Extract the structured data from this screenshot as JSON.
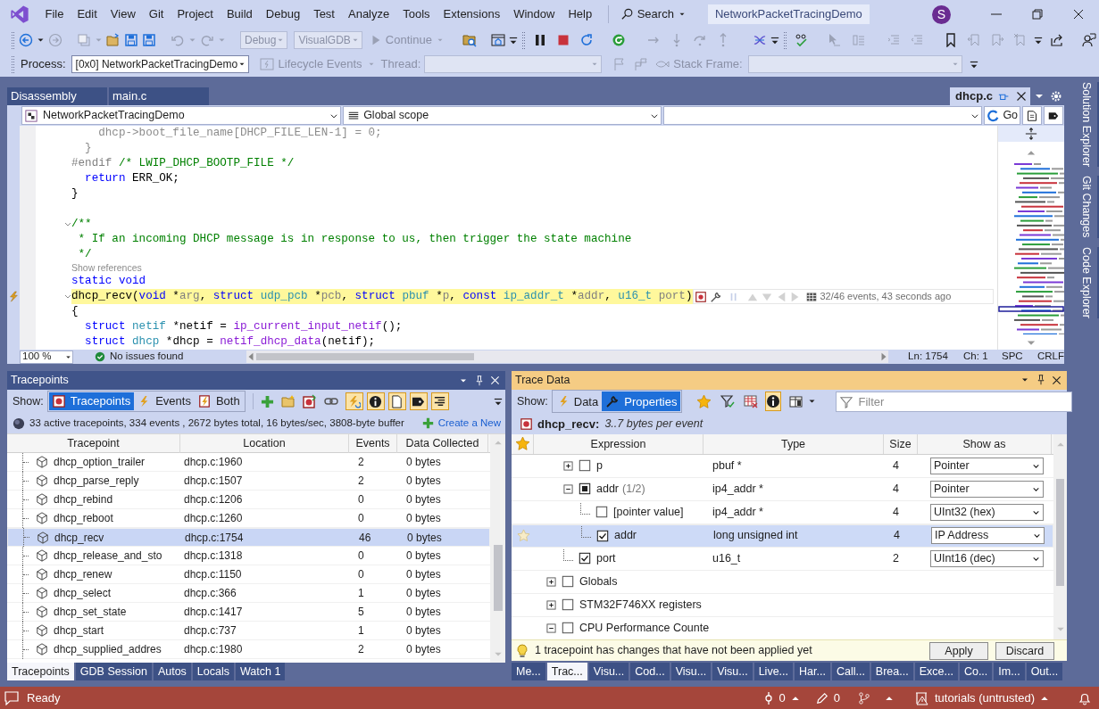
{
  "menu": [
    "File",
    "Edit",
    "View",
    "Git",
    "Project",
    "Build",
    "Debug",
    "Test",
    "Analyze",
    "Tools",
    "Extensions",
    "Window",
    "Help"
  ],
  "search": "Search",
  "solution_title": "NetworkPacketTracingDemo",
  "account_initial": "S",
  "toolbar": {
    "configuration": {
      "value": "Debug",
      "disabled": true
    },
    "platform": {
      "value": "VisualGDB",
      "disabled": true
    },
    "continue": {
      "label": "Continue",
      "disabled": true
    }
  },
  "debug_bar": {
    "process_label": "Process:",
    "process": "[0x0] NetworkPacketTracingDemo",
    "lifecycle": "Lifecycle Events",
    "thread_label": "Thread:",
    "stack_frame_label": "Stack Frame:"
  },
  "editor": {
    "tabs": [
      {
        "label": "Disassembly",
        "selected": false
      },
      {
        "label": "main.c",
        "selected": false
      },
      {
        "label": "dhcp.c",
        "selected": true
      }
    ],
    "nav": {
      "project": "NetworkPacketTracingDemo",
      "scope": "Global scope",
      "go": "Go"
    },
    "lines": [
      {
        "tokens": [
          {
            "kind": "inactive",
            "text": "    dhcp->boot_file_name[DHCP_FILE_LEN-1] = 0;"
          }
        ]
      },
      {
        "tokens": [
          {
            "kind": "inactive",
            "text": "  }"
          }
        ]
      },
      {
        "tokens": [
          {
            "kind": "preproc",
            "text": "#endif"
          },
          {
            "kind": "comment",
            "text": " /* LWIP_DHCP_BOOTP_FILE */"
          }
        ]
      },
      {
        "tokens": [
          {
            "kind": "kw",
            "text": "  return"
          },
          {
            "kind": "plain",
            "text": " ERR_OK;"
          }
        ]
      },
      {
        "tokens": [
          {
            "kind": "plain",
            "text": "}"
          }
        ]
      },
      {
        "kind": "blank"
      },
      {
        "fold": true,
        "tokens": [
          {
            "kind": "comment",
            "text": "/**"
          }
        ]
      },
      {
        "tokens": [
          {
            "kind": "comment",
            "text": " * If an incoming DHCP message is in response to us, then trigger the state machine"
          }
        ]
      },
      {
        "tokens": [
          {
            "kind": "comment",
            "text": " */"
          }
        ]
      },
      {
        "kind": "lens",
        "text": "Show references"
      },
      {
        "tokens": [
          {
            "kind": "kw",
            "text": "static"
          },
          {
            "kind": "kw",
            "text": " void"
          }
        ]
      },
      {
        "fold": true,
        "tracepoint": true,
        "highlight": true,
        "lens": "32/46 events, 43 seconds ago",
        "tokens": [
          {
            "kind": "plain",
            "text": "dhcp_recv("
          },
          {
            "kind": "kw",
            "text": "void"
          },
          {
            "kind": "plain",
            "text": " *"
          },
          {
            "kind": "param",
            "text": "arg"
          },
          {
            "kind": "plain",
            "text": ", "
          },
          {
            "kind": "kw",
            "text": "struct"
          },
          {
            "kind": "type",
            "text": " udp_pcb"
          },
          {
            "kind": "plain",
            "text": " *"
          },
          {
            "kind": "param",
            "text": "pcb"
          },
          {
            "kind": "plain",
            "text": ", "
          },
          {
            "kind": "kw",
            "text": "struct"
          },
          {
            "kind": "type",
            "text": " pbuf"
          },
          {
            "kind": "plain",
            "text": " *"
          },
          {
            "kind": "param",
            "text": "p"
          },
          {
            "kind": "plain",
            "text": ", "
          },
          {
            "kind": "kw",
            "text": "const"
          },
          {
            "kind": "type",
            "text": " ip_addr_t"
          },
          {
            "kind": "plain",
            "text": " *"
          },
          {
            "kind": "param",
            "text": "addr"
          },
          {
            "kind": "plain",
            "text": ", "
          },
          {
            "kind": "type",
            "text": "u16_t"
          },
          {
            "kind": "param",
            "text": " port"
          },
          {
            "kind": "plain",
            "text": ")"
          }
        ]
      },
      {
        "tokens": [
          {
            "kind": "plain",
            "text": "{"
          }
        ]
      },
      {
        "tokens": [
          {
            "kind": "kw",
            "text": "  struct"
          },
          {
            "kind": "type",
            "text": " netif"
          },
          {
            "kind": "plain",
            "text": " *netif = "
          },
          {
            "kind": "func",
            "text": "ip_current_input_netif"
          },
          {
            "kind": "plain",
            "text": "();"
          }
        ]
      },
      {
        "tokens": [
          {
            "kind": "kw",
            "text": "  struct"
          },
          {
            "kind": "type",
            "text": " dhcp"
          },
          {
            "kind": "plain",
            "text": " *dhcp = "
          },
          {
            "kind": "func",
            "text": "netif_dhcp_data"
          },
          {
            "kind": "plain",
            "text": "(netif);"
          }
        ]
      }
    ],
    "status": {
      "zoom": "100 %",
      "issues": "No issues found",
      "line": "Ln: 1754",
      "column": "Ch: 1",
      "indent": "SPC",
      "line_ending": "CRLF"
    }
  },
  "side_tabs": [
    "Solution Explorer",
    "Git Changes",
    "Code Explorer"
  ],
  "tracepoints": {
    "title": "Tracepoints",
    "show_label": "Show:",
    "show": [
      {
        "label": "Tracepoints",
        "selected": true
      },
      {
        "label": "Events",
        "selected": false
      },
      {
        "label": "Both",
        "selected": false
      }
    ],
    "toggles": [
      {
        "on": true
      },
      {
        "on": true
      },
      {
        "on": true
      },
      {
        "on": true
      },
      {
        "on": true
      }
    ],
    "summary": "33 active tracepoints, 334 events , 2672 bytes total, 16 bytes/sec, 3808-byte buffer",
    "create_link": "Create a New",
    "columns": [
      "Tracepoint",
      "Location",
      "Events",
      "Data Collected"
    ],
    "rows": [
      {
        "name": "dhcp_option_trailer",
        "location": "dhcp.c:1960",
        "events": "2",
        "data": "0 bytes",
        "selected": false
      },
      {
        "name": "dhcp_parse_reply",
        "location": "dhcp.c:1507",
        "events": "2",
        "data": "0 bytes",
        "selected": false
      },
      {
        "name": "dhcp_rebind",
        "location": "dhcp.c:1206",
        "events": "0",
        "data": "0 bytes",
        "selected": false
      },
      {
        "name": "dhcp_reboot",
        "location": "dhcp.c:1260",
        "events": "0",
        "data": "0 bytes",
        "selected": false
      },
      {
        "name": "dhcp_recv",
        "location": "dhcp.c:1754",
        "events": "46",
        "data": "0 bytes",
        "selected": true
      },
      {
        "name": "dhcp_release_and_sto",
        "location": "dhcp.c:1318",
        "events": "0",
        "data": "0 bytes",
        "selected": false
      },
      {
        "name": "dhcp_renew",
        "location": "dhcp.c:1150",
        "events": "0",
        "data": "0 bytes",
        "selected": false
      },
      {
        "name": "dhcp_select",
        "location": "dhcp.c:366",
        "events": "1",
        "data": "0 bytes",
        "selected": false
      },
      {
        "name": "dhcp_set_state",
        "location": "dhcp.c:1417",
        "events": "5",
        "data": "0 bytes",
        "selected": false
      },
      {
        "name": "dhcp_start",
        "location": "dhcp.c:737",
        "events": "1",
        "data": "0 bytes",
        "selected": false
      },
      {
        "name": "dhcp_supplied_addres",
        "location": "dhcp.c:1980",
        "events": "2",
        "data": "0 bytes",
        "selected": false
      }
    ],
    "tabs": [
      {
        "label": "Tracepoints",
        "selected": true
      },
      {
        "label": "GDB Session",
        "selected": false
      },
      {
        "label": "Autos",
        "selected": false
      },
      {
        "label": "Locals",
        "selected": false
      },
      {
        "label": "Watch 1",
        "selected": false
      }
    ]
  },
  "trace_data": {
    "title": "Trace Data",
    "active": true,
    "show_label": "Show:",
    "show": [
      {
        "label": "Data",
        "selected": false
      },
      {
        "label": "Properties",
        "selected": true
      }
    ],
    "info_toggle": {
      "on": true
    },
    "filter_placeholder": "Filter",
    "function": "dhcp_recv:",
    "event_size": "3..7 bytes per event",
    "columns": [
      "Expression",
      "Type",
      "Size",
      "Show as"
    ],
    "tree": {
      "continued_children": [
        {
          "name": "p",
          "checked": false,
          "expanded": false,
          "type": "pbuf *",
          "size": "4",
          "show_as": "Pointer",
          "selected": false,
          "starred": false
        },
        {
          "name": "addr",
          "count": "(1/2)",
          "partial": true,
          "expanded": true,
          "type": "ip4_addr *",
          "size": "4",
          "show_as": "Pointer",
          "selected": false,
          "starred": false,
          "children": [
            {
              "name": "[pointer value]",
              "checked": false,
              "type": "ip4_addr *",
              "size": "4",
              "show_as": "UInt32 (hex)",
              "selected": false,
              "starred": false
            },
            {
              "name": "addr",
              "checked": true,
              "type": "long unsigned int",
              "size": "4",
              "show_as": "IP Address",
              "selected": true,
              "starred": true
            }
          ]
        },
        {
          "name": "port",
          "checked": true,
          "type": "u16_t",
          "size": "2",
          "show_as": "UInt16 (dec)",
          "selected": false,
          "starred": false
        }
      ],
      "items": [
        {
          "name": "Globals",
          "checked": false,
          "expanded": false,
          "selected": false,
          "starred": false
        },
        {
          "name": "STM32F746XX registers",
          "checked": false,
          "expanded": false,
          "selected": false,
          "starred": false
        },
        {
          "name": "CPU Performance Counte",
          "checked": false,
          "expanded": true,
          "selected": false,
          "starred": false
        }
      ]
    },
    "notice": "1 tracepoint has changes that have not been applied yet",
    "buttons": [
      "Apply",
      "Discard"
    ],
    "tabs": [
      {
        "label": "Me...",
        "selected": false
      },
      {
        "label": "Trac...",
        "selected": true
      },
      {
        "label": "Visu...",
        "selected": false
      },
      {
        "label": "Cod...",
        "selected": false
      },
      {
        "label": "Visu...",
        "selected": false
      },
      {
        "label": "Visu...",
        "selected": false
      },
      {
        "label": "Live...",
        "selected": false
      },
      {
        "label": "Har...",
        "selected": false
      },
      {
        "label": "Call...",
        "selected": false
      },
      {
        "label": "Brea...",
        "selected": false
      },
      {
        "label": "Exce...",
        "selected": false
      },
      {
        "label": "Co...",
        "selected": false
      },
      {
        "label": "Im...",
        "selected": false
      },
      {
        "label": "Out...",
        "selected": false
      }
    ]
  },
  "status_bar": {
    "message": "Ready",
    "commits": "0",
    "changes": "0",
    "repository": "tutorials (untrusted)"
  }
}
